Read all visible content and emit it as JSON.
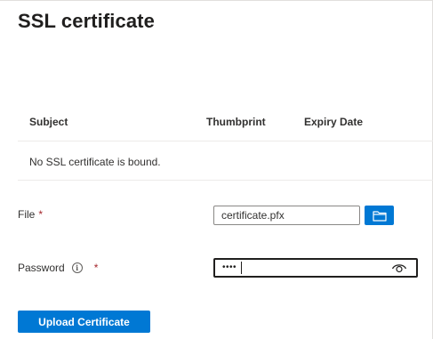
{
  "page": {
    "title": "SSL certificate"
  },
  "table": {
    "columns": [
      "Subject",
      "Thumbprint",
      "Expiry Date"
    ],
    "empty_message": "No SSL certificate is bound."
  },
  "form": {
    "file": {
      "label": "File",
      "required_mark": "*",
      "value": "certificate.pfx",
      "browse_icon": "folder-icon"
    },
    "password": {
      "label": "Password",
      "info_icon": "info-icon",
      "info_glyph": "i",
      "required_mark": "*",
      "masked_value": "••••",
      "toggle_icon": "eye-icon"
    }
  },
  "actions": {
    "upload_label": "Upload Certificate"
  },
  "colors": {
    "accent": "#0078d4",
    "required": "#a4262c",
    "text": "#323130"
  }
}
